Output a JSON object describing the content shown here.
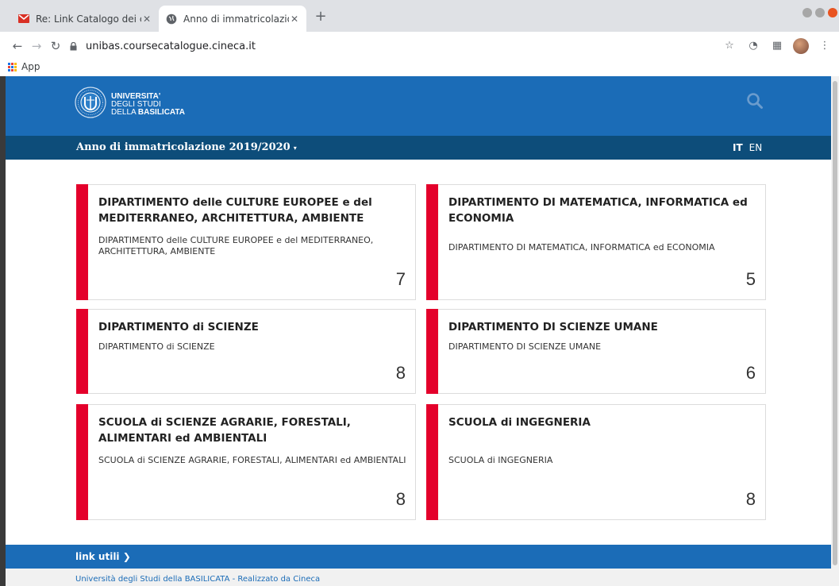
{
  "browser": {
    "tabs": [
      {
        "title": "Re: Link Catalogo dei cors",
        "favicon": "gmail-icon",
        "active": false
      },
      {
        "title": "Anno di immatricolazione",
        "favicon": "globe-icon",
        "active": true
      }
    ],
    "new_tab": "+",
    "url": "unibas.coursecatalogue.cineca.it",
    "bookmarks": {
      "apps_label": "App"
    }
  },
  "site": {
    "logo": {
      "line1": "UNIVERSITA'",
      "line2": "DEGLI STUDI",
      "line3_prefix": "DELLA",
      "line3_bold": "BASILICATA"
    },
    "year_selector": {
      "label": "Anno di immatricolazione",
      "value": "2019/2020",
      "caret": "▾"
    },
    "languages": {
      "it": "IT",
      "en": "EN"
    },
    "cards": [
      {
        "title": "DIPARTIMENTO delle CULTURE EUROPEE e del MEDITERRANEO, ARCHITETTURA, AMBIENTE",
        "desc": "DIPARTIMENTO delle CULTURE EUROPEE e del MEDITERRANEO, ARCHITETTURA, AMBIENTE",
        "count": "7"
      },
      {
        "title": "DIPARTIMENTO DI MATEMATICA, INFORMATICA ed ECONOMIA",
        "desc": "DIPARTIMENTO DI MATEMATICA, INFORMATICA ed ECONOMIA",
        "count": "5"
      },
      {
        "title": "DIPARTIMENTO di SCIENZE",
        "desc": "DIPARTIMENTO di SCIENZE",
        "count": "8"
      },
      {
        "title": "DIPARTIMENTO DI SCIENZE UMANE",
        "desc": "DIPARTIMENTO DI SCIENZE UMANE",
        "count": "6"
      },
      {
        "title": "SCUOLA di SCIENZE AGRARIE, FORESTALI, ALIMENTARI ed AMBIENTALI",
        "desc": "SCUOLA di SCIENZE AGRARIE, FORESTALI, ALIMENTARI ed AMBIENTALI",
        "count": "8"
      },
      {
        "title": "SCUOLA di INGEGNERIA",
        "desc": "SCUOLA di INGEGNERIA",
        "count": "8"
      }
    ],
    "links_bar": {
      "label": "link utili",
      "chevron": "❯"
    },
    "footer": {
      "text": "Università degli Studi della BASILICATA - Realizzato da Cineca"
    },
    "colors": {
      "primary": "#1b6cb7",
      "dark": "#0d4d7a",
      "accent": "#e4002b"
    }
  }
}
